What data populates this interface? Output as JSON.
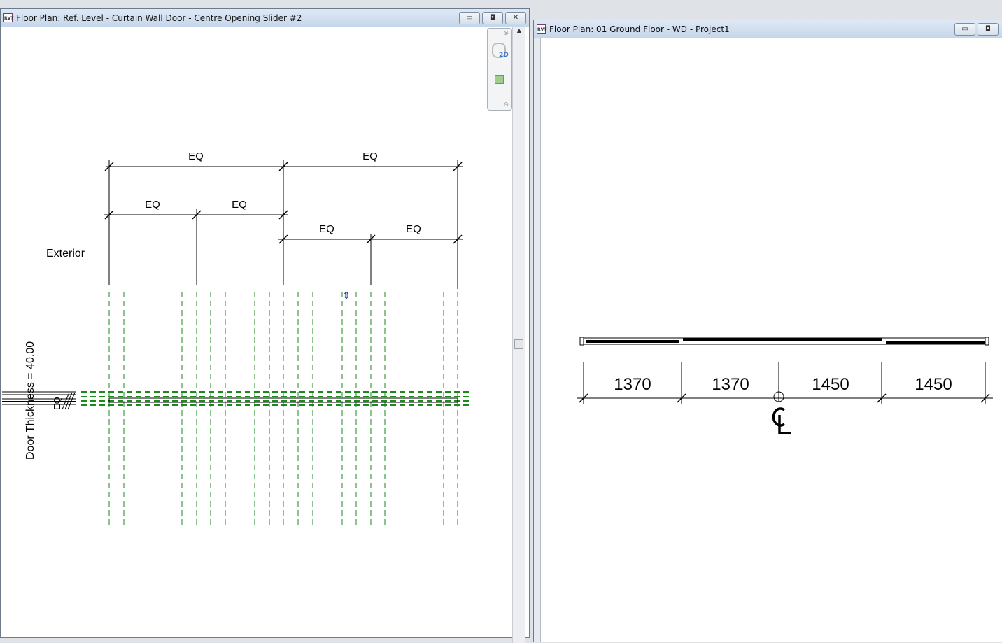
{
  "left_window": {
    "title": "Floor Plan: Ref. Level - Curtain Wall Door - Centre Opening Slider #2",
    "file_icon": "RVT",
    "buttons": {
      "minimize": "▭",
      "restore": "◘",
      "close": "✕"
    },
    "navbar": {
      "wheel_label": "2D"
    },
    "drawing": {
      "dimension_labels": [
        "EQ",
        "EQ",
        "EQ",
        "EQ",
        "EQ",
        "EQ"
      ],
      "side_label": "Exterior",
      "parameter_label": "Door Thickness = 40.00",
      "eq_stack": "EQ"
    }
  },
  "right_window": {
    "title": "Floor Plan: 01 Ground Floor - WD - Project1",
    "file_icon": "RVT",
    "buttons": {
      "minimize": "▭",
      "restore": "◘"
    },
    "drawing": {
      "dimensions": [
        "1370",
        "1370",
        "1450",
        "1450"
      ],
      "centerline_symbol": "CL"
    }
  },
  "colors": {
    "reference_plane": "#1a8a1a",
    "titlebar": "#c6d6ea"
  }
}
